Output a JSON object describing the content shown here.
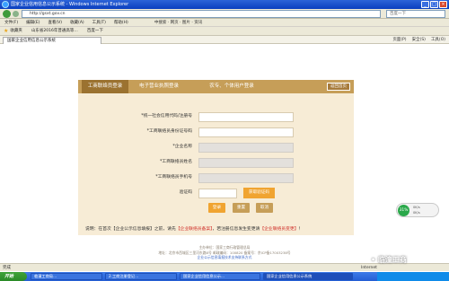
{
  "window": {
    "title": "国家企业信用信息公示系统 - Windows Internet Explorer"
  },
  "address": {
    "url": "http://gsxt.gov.cn",
    "search_placeholder": "百度一下"
  },
  "menu": {
    "items": [
      "文件(F)",
      "编辑(E)",
      "查看(V)",
      "收藏(A)",
      "工具(T)",
      "帮助(H)"
    ],
    "extra": "中搜索 · 网页 · 图片 · 资讯"
  },
  "favorites": {
    "items": [
      "收藏夹",
      "山东省2016年普通高等…",
      "百度一下"
    ]
  },
  "browser_tab": {
    "label": "国家企业信用信息公示系统",
    "tools": [
      "页面(P)",
      "安全(S)",
      "工具(O)"
    ]
  },
  "login": {
    "tabs": [
      "工商联络员登录",
      "电子营业执照登录",
      "农专、个体用户登录"
    ],
    "back_home": "返回首页",
    "fields": [
      {
        "label": "*统一社会信用代码/注册号",
        "disabled": false
      },
      {
        "label": "*工商联络员身份证号码",
        "disabled": false
      },
      {
        "label": "*企业名称",
        "disabled": true
      },
      {
        "label": "*工商联络员姓名",
        "disabled": true
      },
      {
        "label": "*工商联络员手机号",
        "disabled": true
      }
    ],
    "captcha": {
      "label": "验证码",
      "button": "获取验证码"
    },
    "buttons": {
      "login": "登录",
      "reset": "重置",
      "cancel": "取消"
    }
  },
  "note": {
    "prefix": "说明：在首次【企业公示信息填报】之前，请先",
    "link1": "【企业联络员备案】",
    "middle": "，若注册信息发生变更请",
    "link2": "【企业联络员变更】",
    "suffix": "！"
  },
  "footer": {
    "line1": "主办单位：国家工商行政管理总局",
    "line2": "地址：北京市西城区三里河东路8号  邮政编码：100820  备案号：京ICP备17003238号",
    "line3": "企业公示信息填报技术支持联系方式"
  },
  "badge": {
    "percent": "31%",
    "line1": "0K/s",
    "line2": "0K/s"
  },
  "statusbar": {
    "left": "完成",
    "zone": "Internet"
  },
  "taskbar": {
    "start": "开始",
    "tasks": [
      "临潼工商局…",
      "2.工商注册登记…",
      "国家企业信用信息公示…",
      "国家企业信用信息公示系统"
    ]
  },
  "watermark": "• 临潼工商"
}
